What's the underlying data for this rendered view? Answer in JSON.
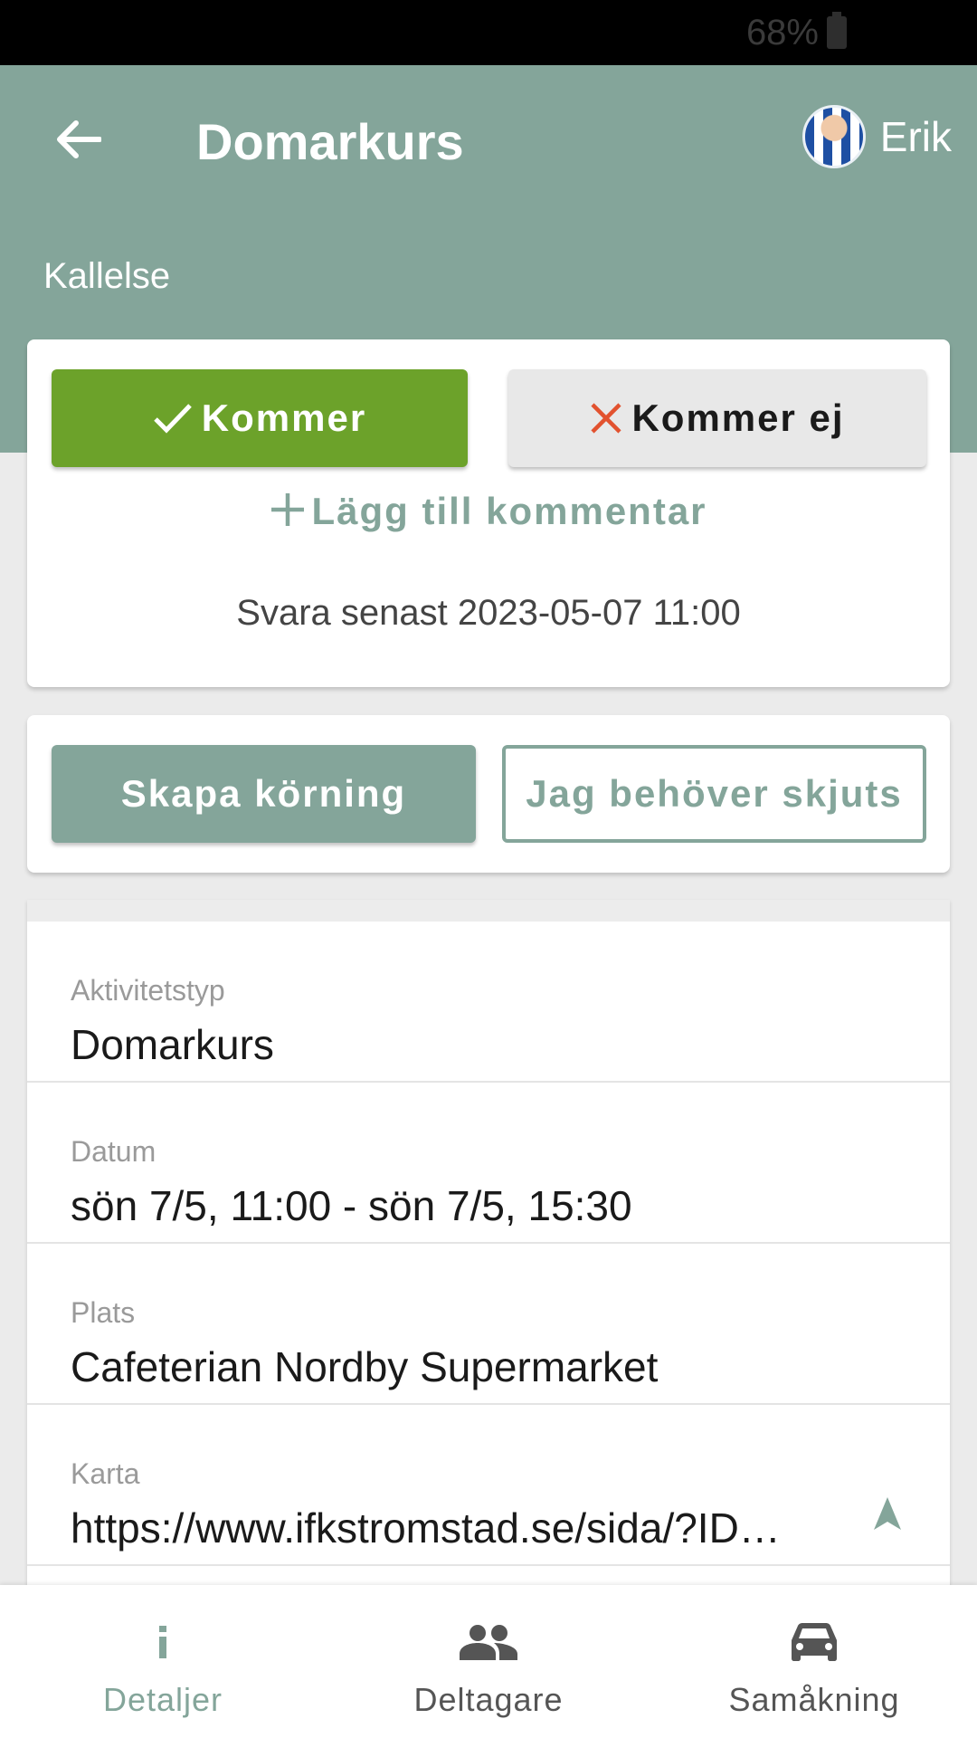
{
  "status_bar": {
    "battery": "68%"
  },
  "header": {
    "title": "Domarkurs",
    "user_name": "Erik",
    "section_label": "Kallelse"
  },
  "rsvp": {
    "coming_label": "Kommer",
    "not_coming_label": "Kommer ej",
    "add_comment_label": "Lägg till kommentar",
    "deadline": "Svara senast 2023-05-07 11:00"
  },
  "rides": {
    "create_label": "Skapa körning",
    "need_ride_label": "Jag behöver skjuts"
  },
  "details": [
    {
      "label": "Aktivitetstyp",
      "value": "Domarkurs"
    },
    {
      "label": "Datum",
      "value": "sön 7/5, 11:00 - sön 7/5, 15:30"
    },
    {
      "label": "Plats",
      "value": "Cafeterian Nordby Supermarket"
    },
    {
      "label": "Karta",
      "value": "https://www.ifkstromstad.se/sida/?ID…"
    }
  ],
  "bottom_nav": {
    "tabs": [
      {
        "label": "Detaljer",
        "icon": "info-icon",
        "active": true
      },
      {
        "label": "Deltagare",
        "icon": "people-icon",
        "active": false
      },
      {
        "label": "Samåkning",
        "icon": "car-icon",
        "active": false
      }
    ]
  },
  "colors": {
    "accent": "#84a59a",
    "coming_green": "#6ca22a",
    "decline_red": "#e2522f"
  }
}
